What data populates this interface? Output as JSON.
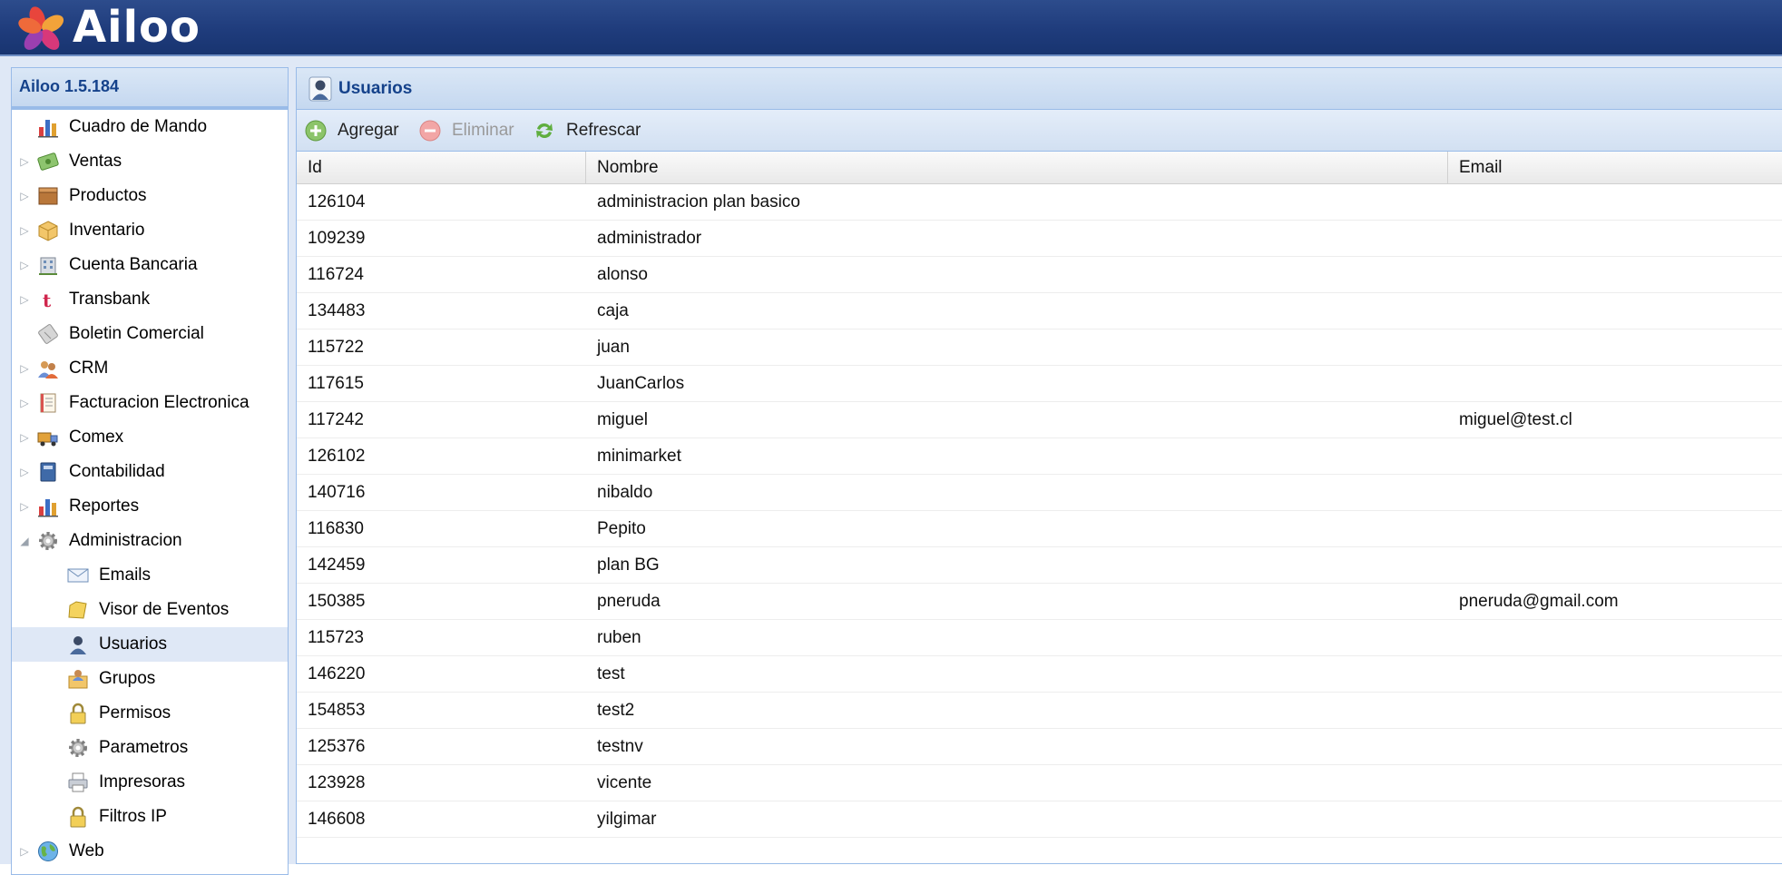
{
  "app": {
    "logo_text": "Ailoo",
    "version": "Ailoo 1.5.184"
  },
  "sidebar": {
    "items": [
      {
        "label": "Cuadro de Mando",
        "icon": "chart-icon",
        "level": 0,
        "expander": "none"
      },
      {
        "label": "Ventas",
        "icon": "money-icon",
        "level": 0,
        "expander": "collapsed"
      },
      {
        "label": "Productos",
        "icon": "box-icon",
        "level": 0,
        "expander": "collapsed"
      },
      {
        "label": "Inventario",
        "icon": "package-icon",
        "level": 0,
        "expander": "collapsed"
      },
      {
        "label": "Cuenta Bancaria",
        "icon": "bank-icon",
        "level": 0,
        "expander": "collapsed"
      },
      {
        "label": "Transbank",
        "icon": "transbank-icon",
        "level": 0,
        "expander": "collapsed"
      },
      {
        "label": "Boletin Comercial",
        "icon": "ticket-icon",
        "level": 0,
        "expander": "none"
      },
      {
        "label": "CRM",
        "icon": "people-icon",
        "level": 0,
        "expander": "collapsed"
      },
      {
        "label": "Facturacion Electronica",
        "icon": "document-icon",
        "level": 0,
        "expander": "collapsed"
      },
      {
        "label": "Comex",
        "icon": "truck-icon",
        "level": 0,
        "expander": "collapsed"
      },
      {
        "label": "Contabilidad",
        "icon": "ledger-icon",
        "level": 0,
        "expander": "collapsed"
      },
      {
        "label": "Reportes",
        "icon": "chart-icon",
        "level": 0,
        "expander": "collapsed"
      },
      {
        "label": "Administracion",
        "icon": "gear-icon",
        "level": 0,
        "expander": "expanded"
      },
      {
        "label": "Emails",
        "icon": "envelope-icon",
        "level": 1,
        "expander": "none"
      },
      {
        "label": "Visor de Eventos",
        "icon": "folder-icon",
        "level": 1,
        "expander": "none"
      },
      {
        "label": "Usuarios",
        "icon": "user-icon",
        "level": 1,
        "expander": "none",
        "selected": true
      },
      {
        "label": "Grupos",
        "icon": "group-icon",
        "level": 1,
        "expander": "none"
      },
      {
        "label": "Permisos",
        "icon": "lock-icon",
        "level": 1,
        "expander": "none"
      },
      {
        "label": "Parametros",
        "icon": "gear-icon",
        "level": 1,
        "expander": "none"
      },
      {
        "label": "Impresoras",
        "icon": "printer-icon",
        "level": 1,
        "expander": "none"
      },
      {
        "label": "Filtros IP",
        "icon": "lock-icon",
        "level": 1,
        "expander": "none"
      },
      {
        "label": "Web",
        "icon": "globe-icon",
        "level": 0,
        "expander": "collapsed"
      }
    ]
  },
  "panel": {
    "title": "Usuarios",
    "icon": "user-icon"
  },
  "toolbar": {
    "add_label": "Agregar",
    "delete_label": "Eliminar",
    "refresh_label": "Refrescar"
  },
  "grid": {
    "columns": [
      "Id",
      "Nombre",
      "Email"
    ],
    "rows": [
      [
        "126104",
        "administracion plan basico",
        ""
      ],
      [
        "109239",
        "administrador",
        ""
      ],
      [
        "116724",
        "alonso",
        ""
      ],
      [
        "134483",
        "caja",
        ""
      ],
      [
        "115722",
        "juan",
        ""
      ],
      [
        "117615",
        "JuanCarlos",
        ""
      ],
      [
        "117242",
        "miguel",
        "miguel@test.cl"
      ],
      [
        "126102",
        "minimarket",
        ""
      ],
      [
        "140716",
        "nibaldo",
        ""
      ],
      [
        "116830",
        "Pepito",
        ""
      ],
      [
        "142459",
        "plan BG",
        ""
      ],
      [
        "150385",
        "pneruda",
        "pneruda@gmail.com"
      ],
      [
        "115723",
        "ruben",
        ""
      ],
      [
        "146220",
        "test",
        ""
      ],
      [
        "154853",
        "test2",
        ""
      ],
      [
        "125376",
        "testnv",
        ""
      ],
      [
        "123928",
        "vicente",
        ""
      ],
      [
        "146608",
        "yilgimar",
        ""
      ]
    ]
  },
  "colors": {
    "topbar": "#1f3c7c",
    "panel_title": "#15428b",
    "selection": "#dfe8f6",
    "border": "#99bbe8"
  }
}
